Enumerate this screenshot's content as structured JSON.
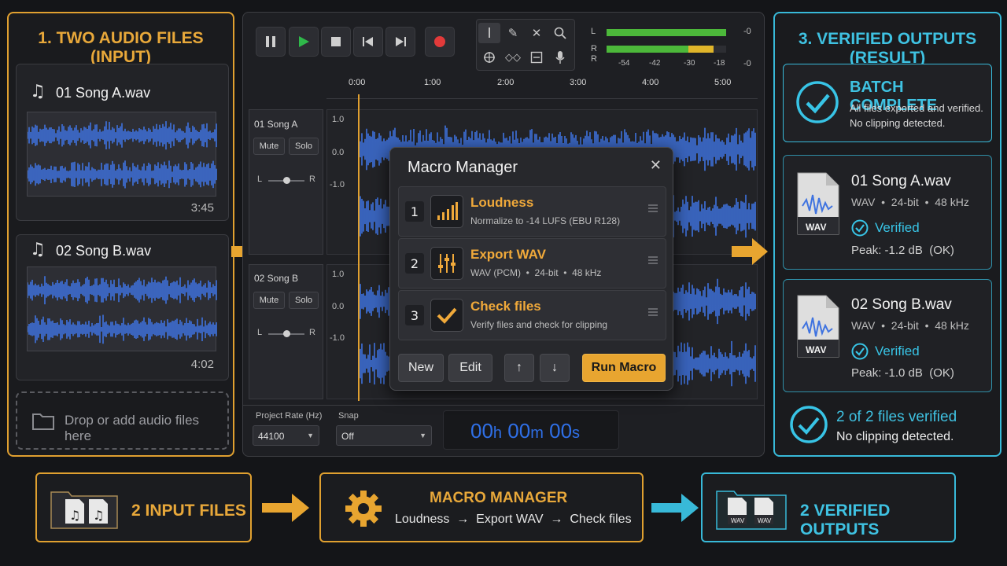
{
  "colors": {
    "accent_orange": "#e0a030",
    "accent_cyan": "#38b9d8",
    "wave_blue": "#3f73e0",
    "play_green": "#2fb84a",
    "record_red": "#e23a3a"
  },
  "input_panel": {
    "title": "1. TWO AUDIO FILES (INPUT)",
    "files": [
      {
        "icon": "music-note-icon",
        "name": "01 Song A.wav",
        "duration": "3:45"
      },
      {
        "icon": "music-note-icon",
        "name": "02 Song B.wav",
        "duration": "4:02"
      }
    ],
    "drop_text": "Drop or add audio files here"
  },
  "daw": {
    "meter": {
      "l": "L",
      "r": "R",
      "scale": [
        "-54",
        "-42",
        "-30",
        "-18"
      ],
      "right_ticks": [
        "-0",
        "-0"
      ]
    },
    "ruler": [
      "0:00",
      "1:00",
      "2:00",
      "3:00",
      "4:00",
      "5:00"
    ],
    "tracks": [
      {
        "name": "01 Song A",
        "mute": "Mute",
        "solo": "Solo",
        "l": "L",
        "r": "R",
        "scale": [
          "1.0",
          "0.0",
          "-1.0"
        ]
      },
      {
        "name": "02 Song B",
        "mute": "Mute",
        "solo": "Solo",
        "l": "L",
        "r": "R",
        "scale": [
          "1.0",
          "0.0",
          "-1.0"
        ]
      }
    ],
    "project_rate_label": "Project Rate (Hz)",
    "project_rate_value": "44100",
    "snap_label": "Snap",
    "snap_value": "Off",
    "time": {
      "h": "00",
      "h_unit": "h",
      "m": "00",
      "m_unit": "m",
      "s": "00",
      "s_unit": "s"
    }
  },
  "macro_manager": {
    "title": "Macro Manager",
    "steps": [
      {
        "num": "1",
        "title": "Loudness",
        "desc": "Normalize to -14 LUFS (EBU R128)",
        "icon": "bars-icon"
      },
      {
        "num": "2",
        "title": "Export WAV",
        "desc": "WAV (PCM)  •  24-bit  •  48 kHz",
        "icon": "sliders-icon"
      },
      {
        "num": "3",
        "title": "Check files",
        "desc": "Verify files and check for clipping",
        "icon": "check-icon"
      }
    ],
    "buttons": {
      "new": "New",
      "edit": "Edit",
      "run": "Run Macro"
    }
  },
  "output_panel": {
    "title": "3. VERIFIED OUTPUTS (RESULT)",
    "batch_title": "BATCH COMPLETE",
    "batch_line1": "All files exported and verified.",
    "batch_line2": "No clipping detected.",
    "outputs": [
      {
        "name": "01 Song A.wav",
        "format": "WAV  •  24-bit  •  48 kHz",
        "status": "Verified",
        "peak": "Peak: -1.2 dB  (OK)",
        "badge": "WAV"
      },
      {
        "name": "02 Song B.wav",
        "format": "WAV  •  24-bit  •  48 kHz",
        "status": "Verified",
        "peak": "Peak: -1.0 dB  (OK)",
        "badge": "WAV"
      }
    ],
    "summary_title": "2 of 2 files verified",
    "summary_sub": "No clipping detected."
  },
  "flow": {
    "input_label": "2 INPUT FILES",
    "macro_title": "MACRO MANAGER",
    "macro_steps": [
      "Loudness",
      "Export WAV",
      "Check files"
    ],
    "output_label": "2 VERIFIED OUTPUTS",
    "badge": "WAV"
  }
}
